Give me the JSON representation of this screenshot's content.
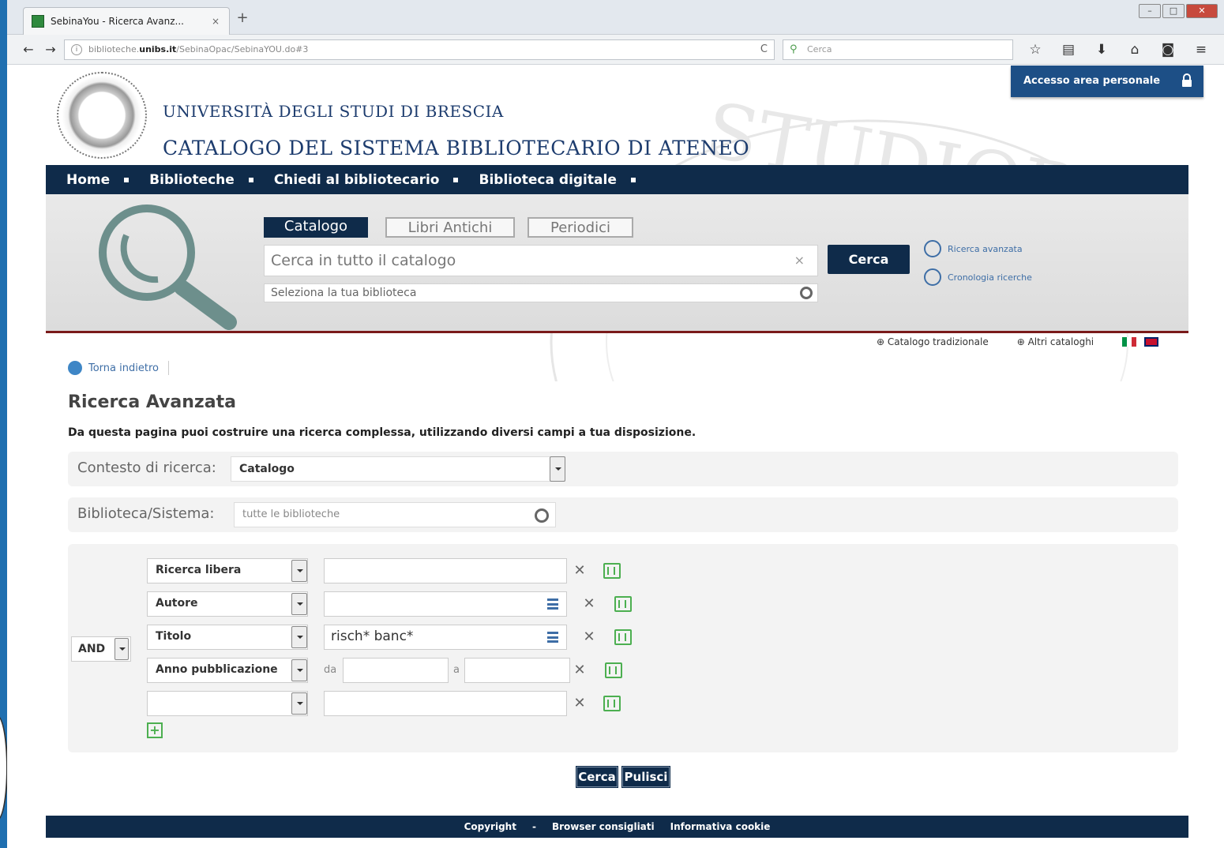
{
  "browser": {
    "tab_title": "SebinaYou - Ricerca Avanz...",
    "tab_close": "×",
    "new_tab": "+",
    "url_prefix": "biblioteche.",
    "url_domain": "unibs.it",
    "url_suffix": "/SebinaOpac/SebinaYOU.do#3",
    "search_placeholder": "Cerca",
    "reload": "C"
  },
  "header": {
    "login_button": "Accesso area personale",
    "university": "UNIVERSITÀ DEGLI STUDI DI BRESCIA",
    "catalog": "CATALOGO DEL SISTEMA BIBLIOTECARIO DI ATENEO",
    "watermark": "STUDIORUM"
  },
  "mainnav": {
    "items": [
      "Home",
      "Biblioteche",
      "Chiedi al bibliotecario",
      "Biblioteca digitale"
    ]
  },
  "search": {
    "tabs": [
      "Catalogo",
      "Libri Antichi",
      "Periodici"
    ],
    "main_placeholder": "Cerca in tutto il catalogo",
    "clear": "×",
    "library_placeholder": "Seleziona la tua biblioteca",
    "button": "Cerca",
    "advanced_link": "Ricerca avanzata",
    "history_link": "Cronologia ricerche"
  },
  "alt_links": {
    "traditional": "⊕ Catalogo tradizionale",
    "others": "⊕ Altri cataloghi"
  },
  "back_link": "Torna indietro",
  "advanced": {
    "title": "Ricerca Avanzata",
    "description": "Da questa pagina puoi costruire una ricerca complessa, utilizzando diversi campi a tua disposizione.",
    "context_label": "Contesto di ricerca:",
    "context_value": "Catalogo",
    "library_label": "Biblioteca/Sistema:",
    "library_placeholder": "tutte le biblioteche",
    "operator": "AND",
    "rows": [
      {
        "field": "Ricerca libera",
        "value": ""
      },
      {
        "field": "Autore",
        "value": ""
      },
      {
        "field": "Titolo",
        "value": "risch* banc*"
      },
      {
        "field": "Anno pubblicazione",
        "from_label": "da",
        "to_label": "a"
      },
      {
        "field": "",
        "value": ""
      }
    ],
    "remove_glyph": "✕",
    "add_glyph": "+",
    "cerca_button": "Cerca",
    "pulisci_button": "Pulisci"
  },
  "footer": {
    "copyright": "Copyright",
    "dash": "-",
    "browsers": "Browser consigliati",
    "cookie": "Informativa cookie"
  },
  "colors": {
    "navy": "#0f2b4a",
    "link_blue": "#3e6ea6",
    "accent_green": "#4caf50",
    "band_border": "#7a1a1a"
  }
}
